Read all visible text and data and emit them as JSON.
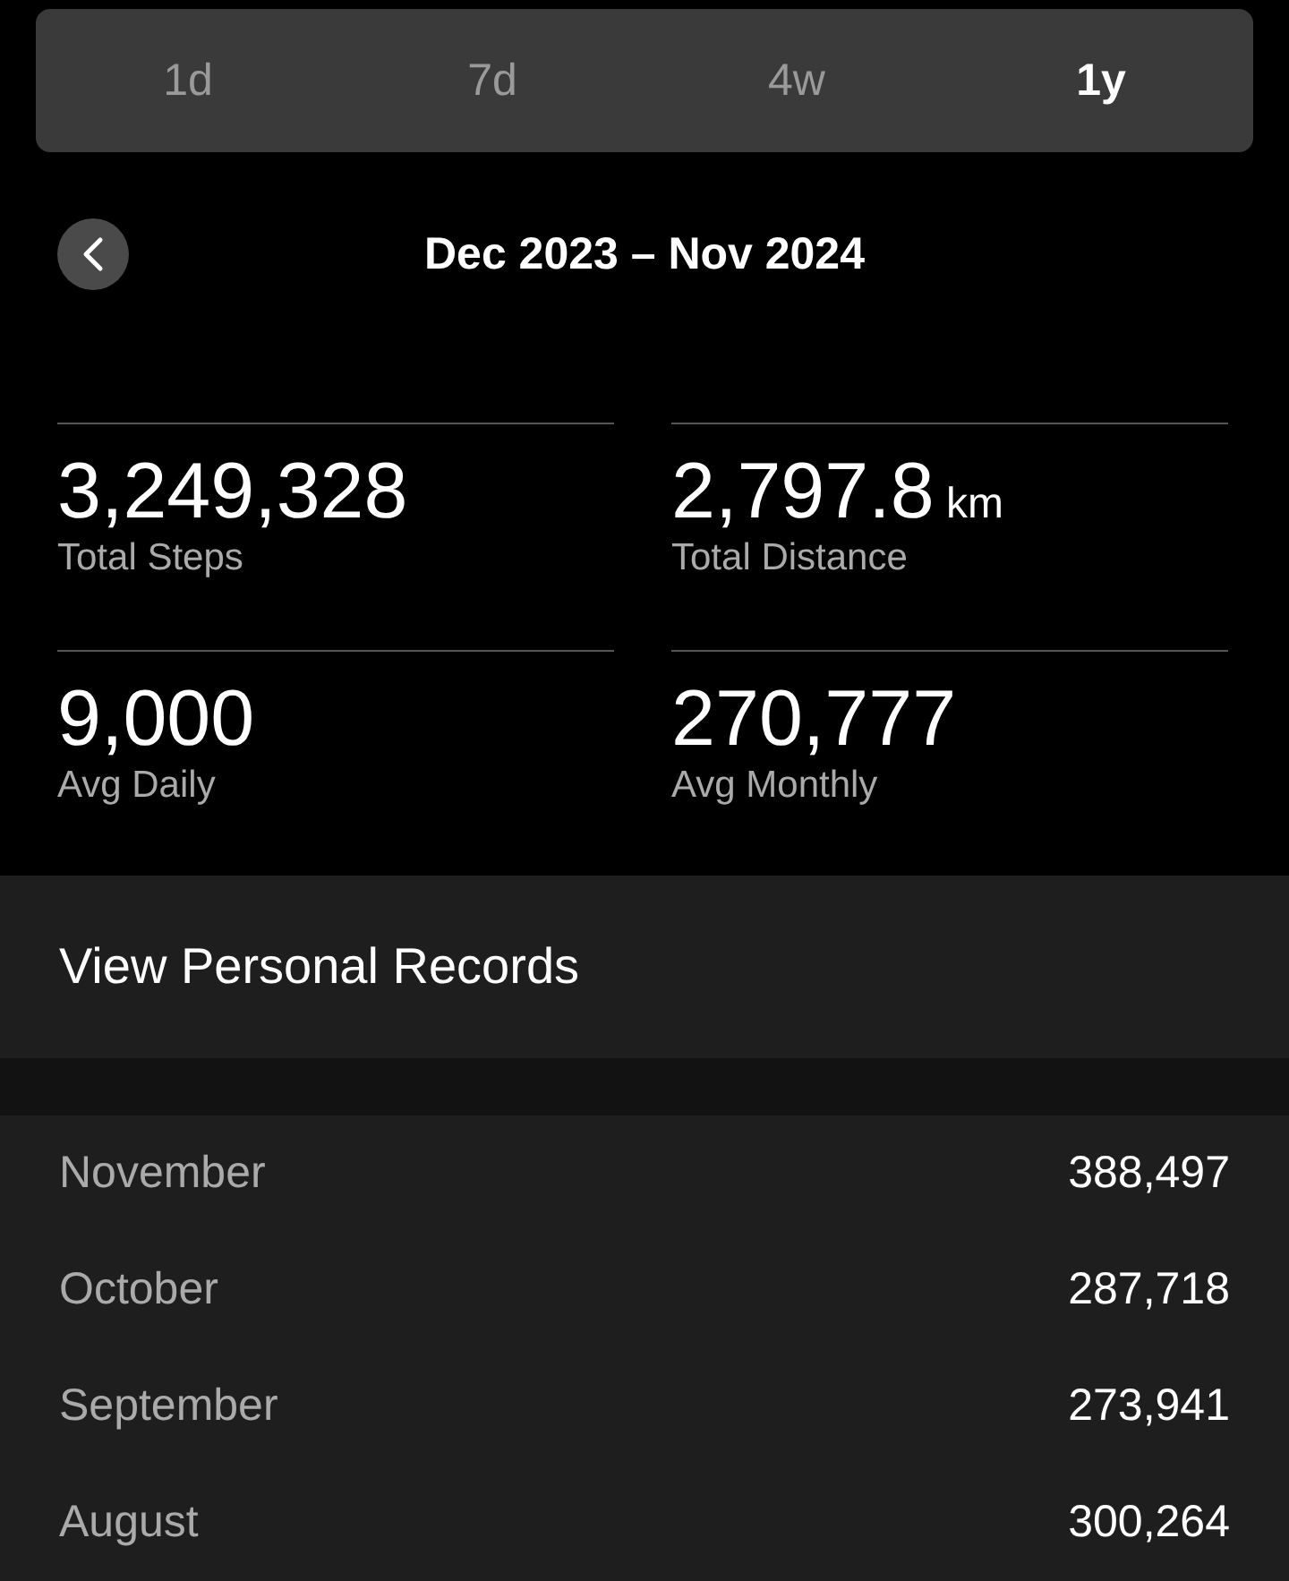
{
  "tabs": [
    {
      "label": "1d",
      "selected": false
    },
    {
      "label": "7d",
      "selected": false
    },
    {
      "label": "4w",
      "selected": false
    },
    {
      "label": "1y",
      "selected": true
    }
  ],
  "period": {
    "title": "Dec 2023 – Nov 2024"
  },
  "stats": [
    {
      "value": "3,249,328",
      "label": "Total Steps"
    },
    {
      "value": "2,797.8",
      "unit": "km",
      "label": "Total Distance"
    },
    {
      "value": "9,000",
      "label": "Avg Daily"
    },
    {
      "value": "270,777",
      "label": "Avg Monthly"
    }
  ],
  "records_link": "View Personal Records",
  "months": [
    {
      "name": "November",
      "steps": "388,497"
    },
    {
      "name": "October",
      "steps": "287,718"
    },
    {
      "name": "September",
      "steps": "273,941"
    },
    {
      "name": "August",
      "steps": "300,264"
    }
  ]
}
